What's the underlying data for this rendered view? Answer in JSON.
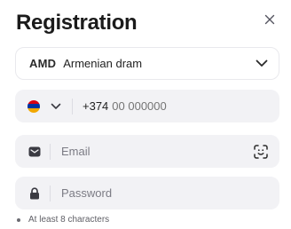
{
  "title": "Registration",
  "close_icon": "close-icon",
  "currency": {
    "code": "AMD",
    "name": "Armenian dram",
    "icon": "chevron-down-icon"
  },
  "phone": {
    "flag": "armenia-flag-icon",
    "flag_colors": [
      "#d90012",
      "#0033a0",
      "#f2a800"
    ],
    "prefix": "+374",
    "placeholder": "00 000000"
  },
  "email": {
    "icon": "mail-icon",
    "placeholder": "Email",
    "action_icon": "scan-face-icon"
  },
  "password": {
    "icon": "lock-icon",
    "placeholder": "Password"
  },
  "hint": "At least 8 characters",
  "colors": {
    "field_bg": "#f2f2f5",
    "border": "#e9e9ed",
    "icon": "#3a3a42"
  }
}
